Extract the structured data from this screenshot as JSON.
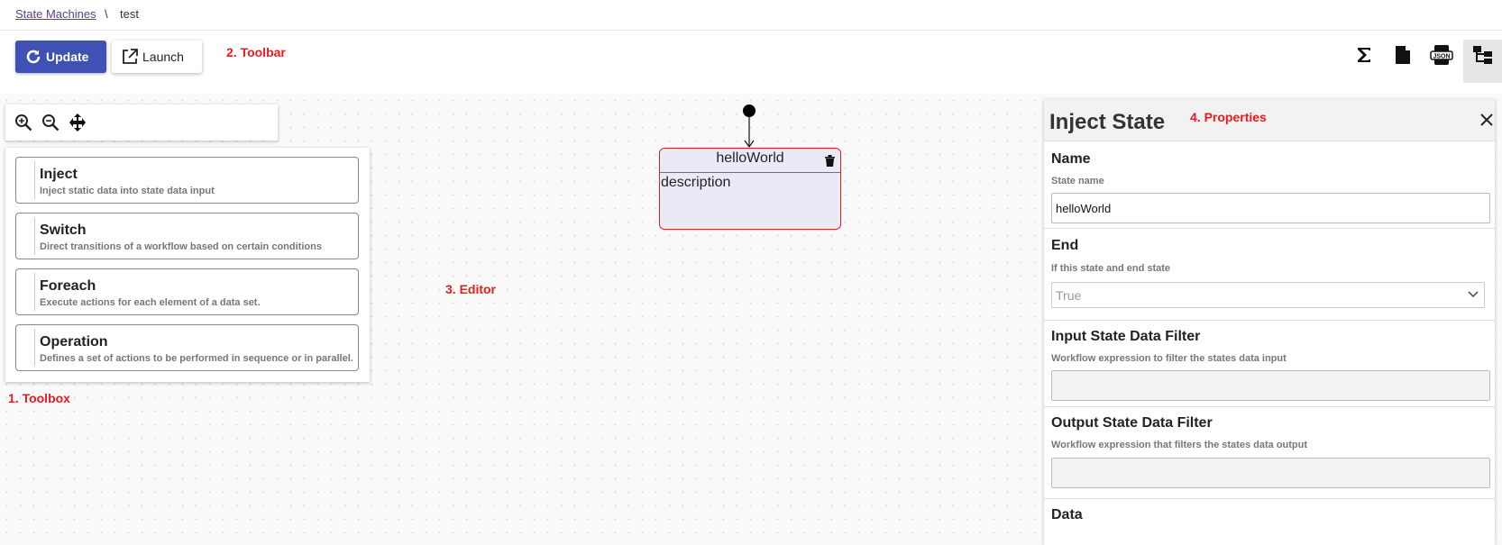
{
  "breadcrumb": {
    "parent": "State Machines",
    "separator": "\\",
    "current": "test"
  },
  "toolbar": {
    "update_label": "Update",
    "launch_label": "Launch",
    "annotation": "2. Toolbar",
    "icons": [
      "sigma-icon",
      "file-icon",
      "json-icon",
      "tree-view-icon"
    ],
    "icon_json_text": "JSON"
  },
  "colors": {
    "primary": "#3f51b5",
    "annotation": "#e02020",
    "state_border": "#e02020",
    "state_fill": "#eaeaf7"
  },
  "toolbox": {
    "annotation": "1. Toolbox",
    "zoom_icons": [
      "zoom-in-icon",
      "zoom-out-icon",
      "move-icon"
    ],
    "items": [
      {
        "title": "Inject",
        "desc": "Inject static data into state data input"
      },
      {
        "title": "Switch",
        "desc": "Direct transitions of a workflow based on certain conditions"
      },
      {
        "title": "Foreach",
        "desc": "Execute actions for each element of a data set."
      },
      {
        "title": "Operation",
        "desc": "Defines a set of actions to be performed in sequence or in parallel."
      }
    ]
  },
  "editor": {
    "annotation": "3. Editor",
    "state": {
      "name": "helloWorld",
      "description": "description"
    }
  },
  "properties": {
    "title": "Inject State",
    "annotation": "4. Properties",
    "name": {
      "title": "Name",
      "help": "State name",
      "value": "helloWorld"
    },
    "end": {
      "title": "End",
      "help": "If this state and end state",
      "value": "True"
    },
    "input_filter": {
      "title": "Input State Data Filter",
      "help": "Workflow expression to filter the states data input",
      "value": ""
    },
    "output_filter": {
      "title": "Output State Data Filter",
      "help": "Workflow expression that filters the states data output",
      "value": ""
    },
    "data": {
      "title": "Data"
    }
  }
}
